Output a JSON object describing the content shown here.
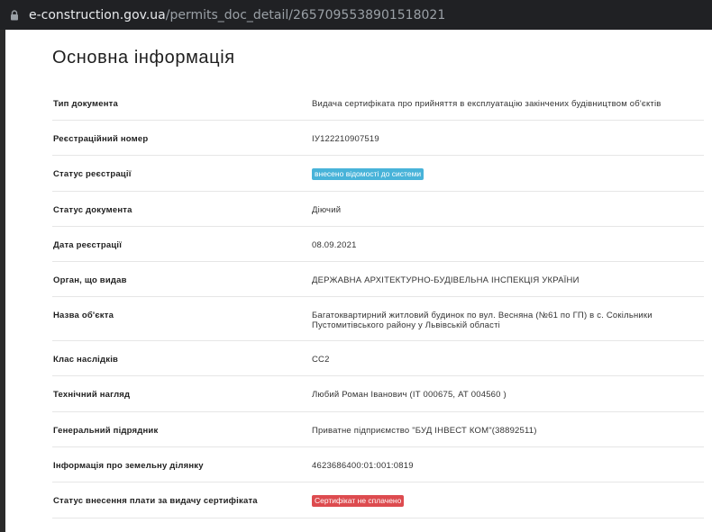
{
  "browser": {
    "url_host": "e-construction.gov.ua",
    "url_path": "/permits_doc_detail/2657095538901518021"
  },
  "page_title": "Основна інформація",
  "badge_colors": {
    "info": "#48b3d9",
    "danger": "#dd4b4f"
  },
  "rows": [
    {
      "label": "Тип документа",
      "value": "Видача сертифіката про прийняття в експлуатацію закінчених будівництвом об'єктів"
    },
    {
      "label": "Реєстраційний номер",
      "value": "ІУ122210907519"
    },
    {
      "label": "Статус реєстрації",
      "badge": "внесено відомості до системи",
      "badge_type": "info"
    },
    {
      "label": "Статус документа",
      "value": "Діючий"
    },
    {
      "label": "Дата реєстрації",
      "value": "08.09.2021"
    },
    {
      "label": "Орган, що видав",
      "value": "ДЕРЖАВНА АРХІТЕКТУРНО-БУДІВЕЛЬНА ІНСПЕКЦІЯ УКРАЇНИ"
    },
    {
      "label": "Назва об'єкта",
      "value": "Багатоквартирний житловий будинок по вул. Весняна (№61 по ГП) в с. Сокільники Пустомитівського району у Львівській області"
    },
    {
      "label": "Клас наслідків",
      "value": "СС2"
    },
    {
      "label": "Технічний нагляд",
      "value": "Любий Роман Іванович (ІТ 000675, АТ 004560 )"
    },
    {
      "label": "Генеральний підрядник",
      "value": "Приватне підприємство \"БУД ІНВЕСТ КОМ\"(38892511)"
    },
    {
      "label": "Інформація про земельну ділянку",
      "value": "4623686400:01:001:0819"
    },
    {
      "label": "Статус внесення плати за видачу сертифіката",
      "badge": "Сертифікат не сплачено",
      "badge_type": "danger"
    }
  ]
}
